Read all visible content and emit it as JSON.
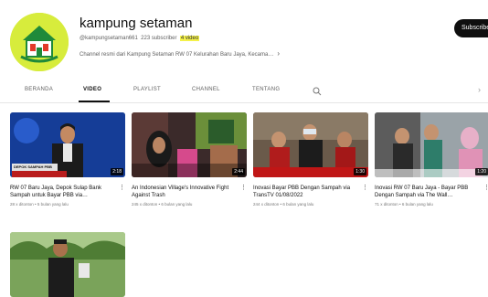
{
  "channel": {
    "name": "kampung setaman",
    "handle": "@kampungsetaman661",
    "subscribers": "223 subscriber",
    "video_count": "4 video",
    "description": "Channel resmi dari Kampung Setaman RW 07 Kelurahan Baru Jaya, Kecama…",
    "subscribe_label": "Subscribe"
  },
  "tabs": [
    "BERANDA",
    "VIDEO",
    "PLAYLIST",
    "CHANNEL",
    "TENTANG"
  ],
  "active_tab": "VIDEO",
  "videos": [
    {
      "title": "RW 07 Baru Jaya, Depok Sulap Bank Sampah untuk Bayar PBB via…",
      "meta": "28 x ditonton • 5 bulan yang lalu",
      "duration": "2:18",
      "thumb_caption": "DEPOK SAMPAH PBB"
    },
    {
      "title": "An Indonesian Village's Innovative Fight Against Trash",
      "meta": "245 x ditonton • 6 bulan yang lalu",
      "duration": "2:44",
      "thumb_caption": ""
    },
    {
      "title": "Inovasi Bayar PBB Dengan Sampah via TransTV 01/08/2022",
      "meta": "244 x ditonton • 6 bulan yang lalu",
      "duration": "1:30",
      "thumb_caption": ""
    },
    {
      "title": "Inovasi RW 07 Baru Jaya - Bayar PBB Dengan Sampah via The Wall…",
      "meta": "71 x ditonton • 6 bulan yang lalu",
      "duration": "1:20",
      "thumb_caption": ""
    },
    {
      "title": "",
      "meta": "",
      "duration": "",
      "thumb_caption": ""
    }
  ],
  "colors": {
    "avatar_bg": "#d7ec3c",
    "subscribe_bg": "#0f0f0f",
    "highlight": "#f4f14a"
  },
  "icons": {
    "search": "search-icon",
    "next": "chevron-right-icon",
    "menu": "more-vertical-icon"
  }
}
